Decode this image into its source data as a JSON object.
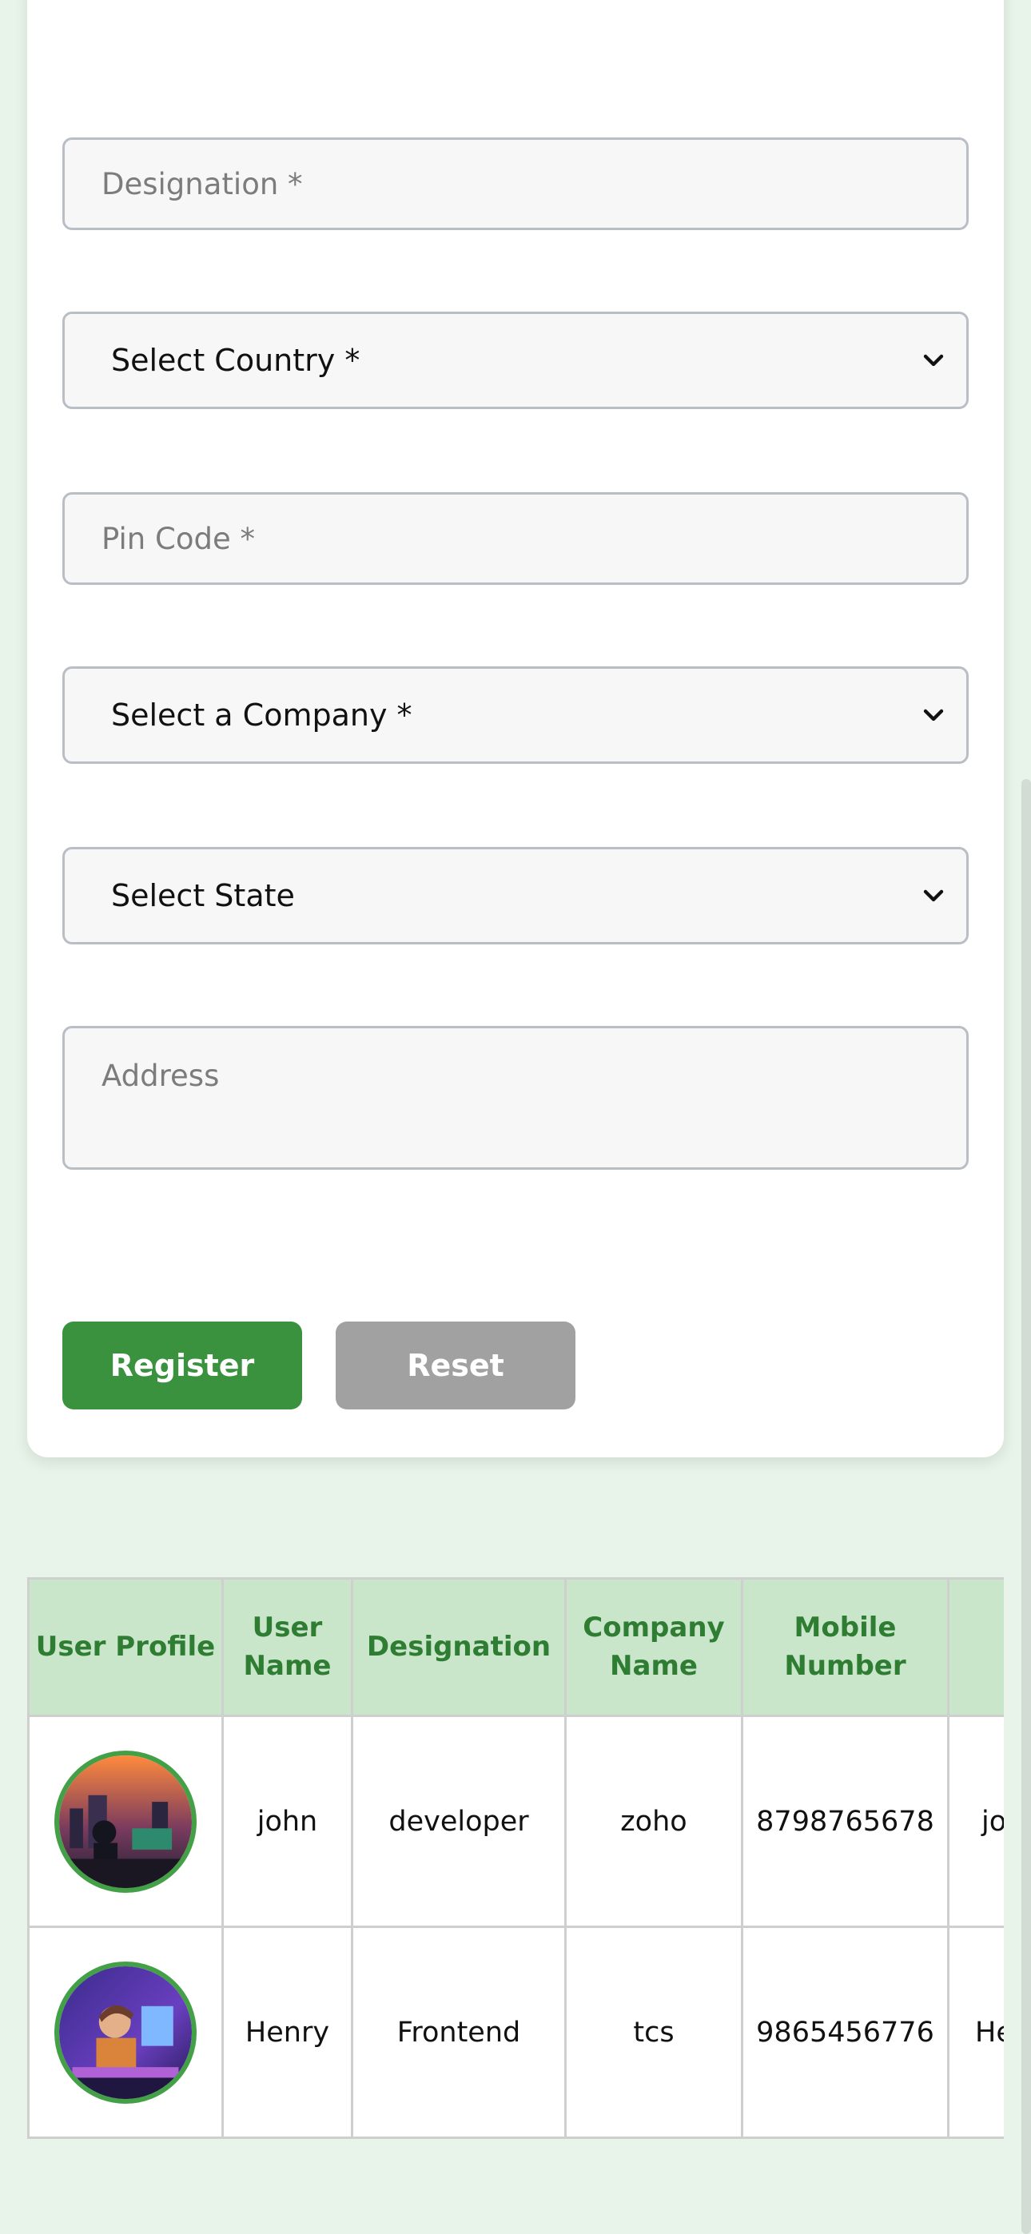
{
  "form": {
    "designation_placeholder": "Designation *",
    "country_select": "Select Country *",
    "pincode_placeholder": "Pin Code *",
    "company_select": "Select a Company *",
    "state_select": "Select State",
    "address_placeholder": "Address",
    "register_label": "Register",
    "reset_label": "Reset"
  },
  "table": {
    "headers": [
      "User Profile",
      "User Name",
      "Designation",
      "Company Name",
      "Mobile Number"
    ],
    "rows": [
      {
        "name": "john",
        "designation": "developer",
        "company": "zoho",
        "mobile": "8798765678",
        "next": "jo"
      },
      {
        "name": "Henry",
        "designation": "Frontend",
        "company": "tcs",
        "mobile": "9865456776",
        "next": "He"
      }
    ]
  },
  "colors": {
    "accent": "#3a923f",
    "header_bg": "#c9e6cb",
    "header_text": "#2e7d32",
    "page_bg": "#e8f4ea"
  }
}
